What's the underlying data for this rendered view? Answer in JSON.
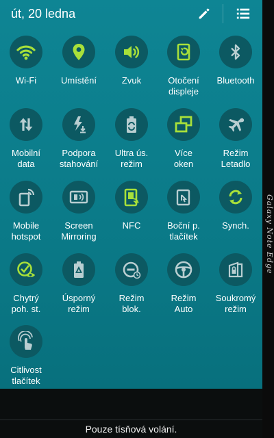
{
  "header": {
    "date": "út, 20 ledna"
  },
  "edge_label": "Galaxy Note Edge",
  "tiles": [
    {
      "label": "Wi-Fi",
      "icon": "wifi-icon",
      "active": true
    },
    {
      "label": "Umístění",
      "icon": "location-pin-icon",
      "active": true
    },
    {
      "label": "Zvuk",
      "icon": "speaker-icon",
      "active": true
    },
    {
      "label": "Otočení\ndispleje",
      "icon": "screen-rotation-icon",
      "active": true
    },
    {
      "label": "Bluetooth",
      "icon": "bluetooth-icon",
      "active": false
    },
    {
      "label": "Mobilní\ndata",
      "icon": "mobile-data-icon",
      "active": false
    },
    {
      "label": "Podpora\nstahování",
      "icon": "download-booster-icon",
      "active": false
    },
    {
      "label": "Ultra ús.\nrežim",
      "icon": "ultra-power-saving-icon",
      "active": false
    },
    {
      "label": "Více\noken",
      "icon": "multi-window-icon",
      "active": true
    },
    {
      "label": "Režim\nLetadlo",
      "icon": "airplane-icon",
      "active": false
    },
    {
      "label": "Mobile\nhotspot",
      "icon": "mobile-hotspot-icon",
      "active": false
    },
    {
      "label": "Screen\nMirroring",
      "icon": "screen-mirroring-icon",
      "active": false
    },
    {
      "label": "NFC",
      "icon": "nfc-icon",
      "active": true
    },
    {
      "label": "Boční p.\ntlačítek",
      "icon": "side-key-panel-icon",
      "active": false
    },
    {
      "label": "Synch.",
      "icon": "sync-icon",
      "active": true
    },
    {
      "label": "Chytrý\npoh. st.",
      "icon": "smart-stay-icon",
      "active": true
    },
    {
      "label": "Úsporný\nrežim",
      "icon": "power-saving-icon",
      "active": false
    },
    {
      "label": "Režim\nblok.",
      "icon": "blocking-mode-icon",
      "active": false
    },
    {
      "label": "Režim\nAuto",
      "icon": "car-mode-icon",
      "active": false
    },
    {
      "label": "Soukromý\nrežim",
      "icon": "private-mode-icon",
      "active": false
    },
    {
      "label": "Citlivost\ntlačítek",
      "icon": "touch-sensitivity-icon",
      "active": false
    }
  ],
  "status": {
    "text": "Pouze tísňová volání."
  },
  "colors": {
    "active": "#a8e03a",
    "inactive": "#b9ced1",
    "panel": "#0e8291",
    "circle": "#0c5962"
  }
}
